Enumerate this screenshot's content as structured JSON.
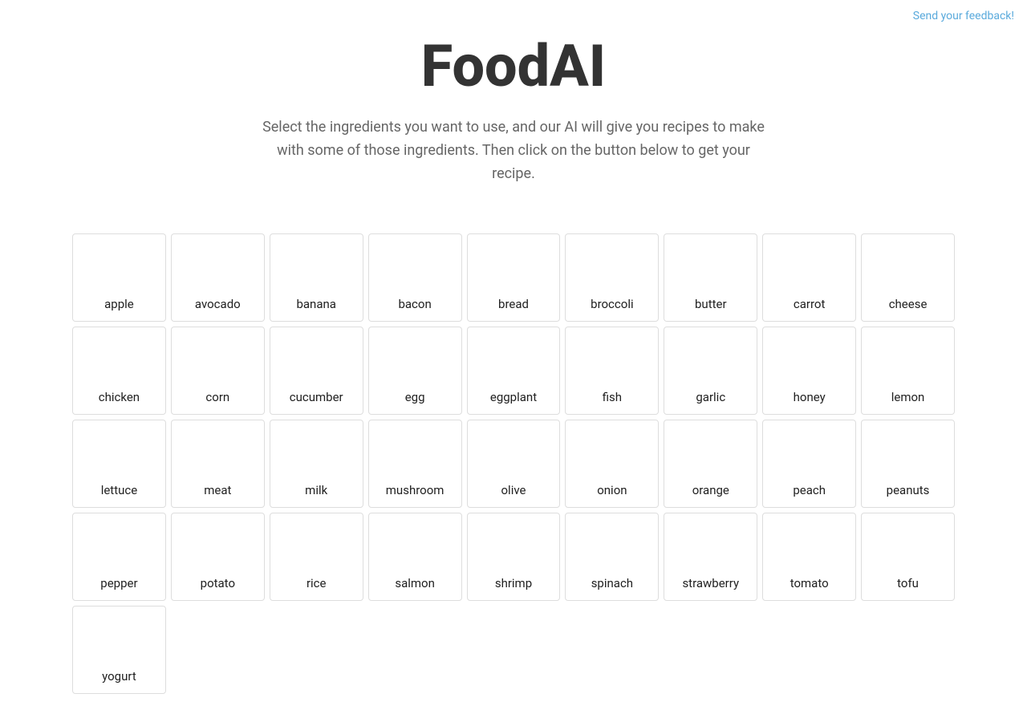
{
  "feedback": {
    "label": "Send your feedback!"
  },
  "header": {
    "title": "FoodAI",
    "subtitle": "Select the ingredients you want to use, and our AI will give you recipes to make with some of those ingredients. Then click on the button below to get your recipe."
  },
  "ingredients": [
    "apple",
    "avocado",
    "banana",
    "bacon",
    "bread",
    "broccoli",
    "butter",
    "carrot",
    "cheese",
    "chicken",
    "corn",
    "cucumber",
    "egg",
    "eggplant",
    "fish",
    "garlic",
    "honey",
    "lemon",
    "lettuce",
    "meat",
    "milk",
    "mushroom",
    "olive",
    "onion",
    "orange",
    "peach",
    "peanuts",
    "pepper",
    "potato",
    "rice",
    "salmon",
    "shrimp",
    "spinach",
    "strawberry",
    "tomato",
    "tofu",
    "yogurt"
  ]
}
